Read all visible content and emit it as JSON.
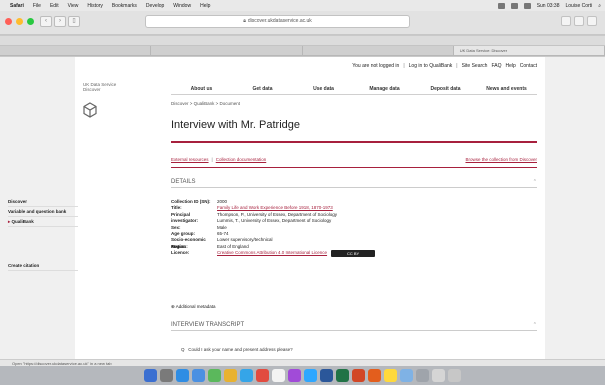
{
  "menubar": {
    "app": "Safari",
    "items": [
      "File",
      "Edit",
      "View",
      "History",
      "Bookmarks",
      "Develop",
      "Window",
      "Help"
    ],
    "clock": "Sun 03:38",
    "user": "Louise Corti"
  },
  "browser": {
    "url": "discover.ukdataservice.ac.uk",
    "tab_active": "UK Data Service: Discover",
    "colors": {
      "close": "#ff5f57",
      "min": "#febc2e",
      "max": "#28c840"
    }
  },
  "topnav": {
    "not_logged_in": "You are not logged in",
    "login": "Log in to QualiBank",
    "site_search": "Site Search",
    "faq": "FAQ",
    "help": "Help",
    "contact": "Contact"
  },
  "logo": {
    "line1": "UK Data Service",
    "line2": "Discover"
  },
  "mainnav": [
    "About us",
    "Get data",
    "Use data",
    "Manage data",
    "Deposit data",
    "News and events"
  ],
  "breadcrumb": "Discover > QualiBank > Document",
  "page_title": "Interview with Mr. Patridge",
  "sidebar": {
    "items": [
      "Discover",
      "Variable and question bank",
      "QualiBank"
    ],
    "create_citation": "Create citation"
  },
  "links": {
    "external": "External resources",
    "documentation": "Collection documentation",
    "browse": "Browse the collection from Discover"
  },
  "details": {
    "heading": "DETAILS",
    "rows": [
      {
        "label": "Collection ID (SN):",
        "value": "2000",
        "link": false
      },
      {
        "label": "Title:",
        "value": "Family Life and Work Experience Before 1918, 1870-1973",
        "link": true
      },
      {
        "label": "Principal investigator:",
        "value": "Thompson, P., University of Essex, Department of Sociology",
        "link": false
      },
      {
        "label": "",
        "value": "Lummis, T., University of Essex, Department of Sociology",
        "link": false
      },
      {
        "label": "Sex:",
        "value": "Male",
        "link": false
      },
      {
        "label": "Age group:",
        "value": "65-74",
        "link": false
      },
      {
        "label": "Socio-economic status:",
        "value": "Lower supervisory/technical",
        "link": false
      },
      {
        "label": "Region:",
        "value": "East of England",
        "link": false
      },
      {
        "label": "Licence:",
        "value": "Creative Commons Attribution 4.0 International Licence",
        "link": true
      }
    ],
    "cc_badge": "CC BY"
  },
  "additional": "Additional metadata",
  "transcript_heading": "INTERVIEW TRANSCRIPT",
  "question": "Could I ask your name and present address please?",
  "statusbar": "Open \"https://discover.ukdataservice.ac.uk\" in a new tab",
  "accent": "#a7203d"
}
